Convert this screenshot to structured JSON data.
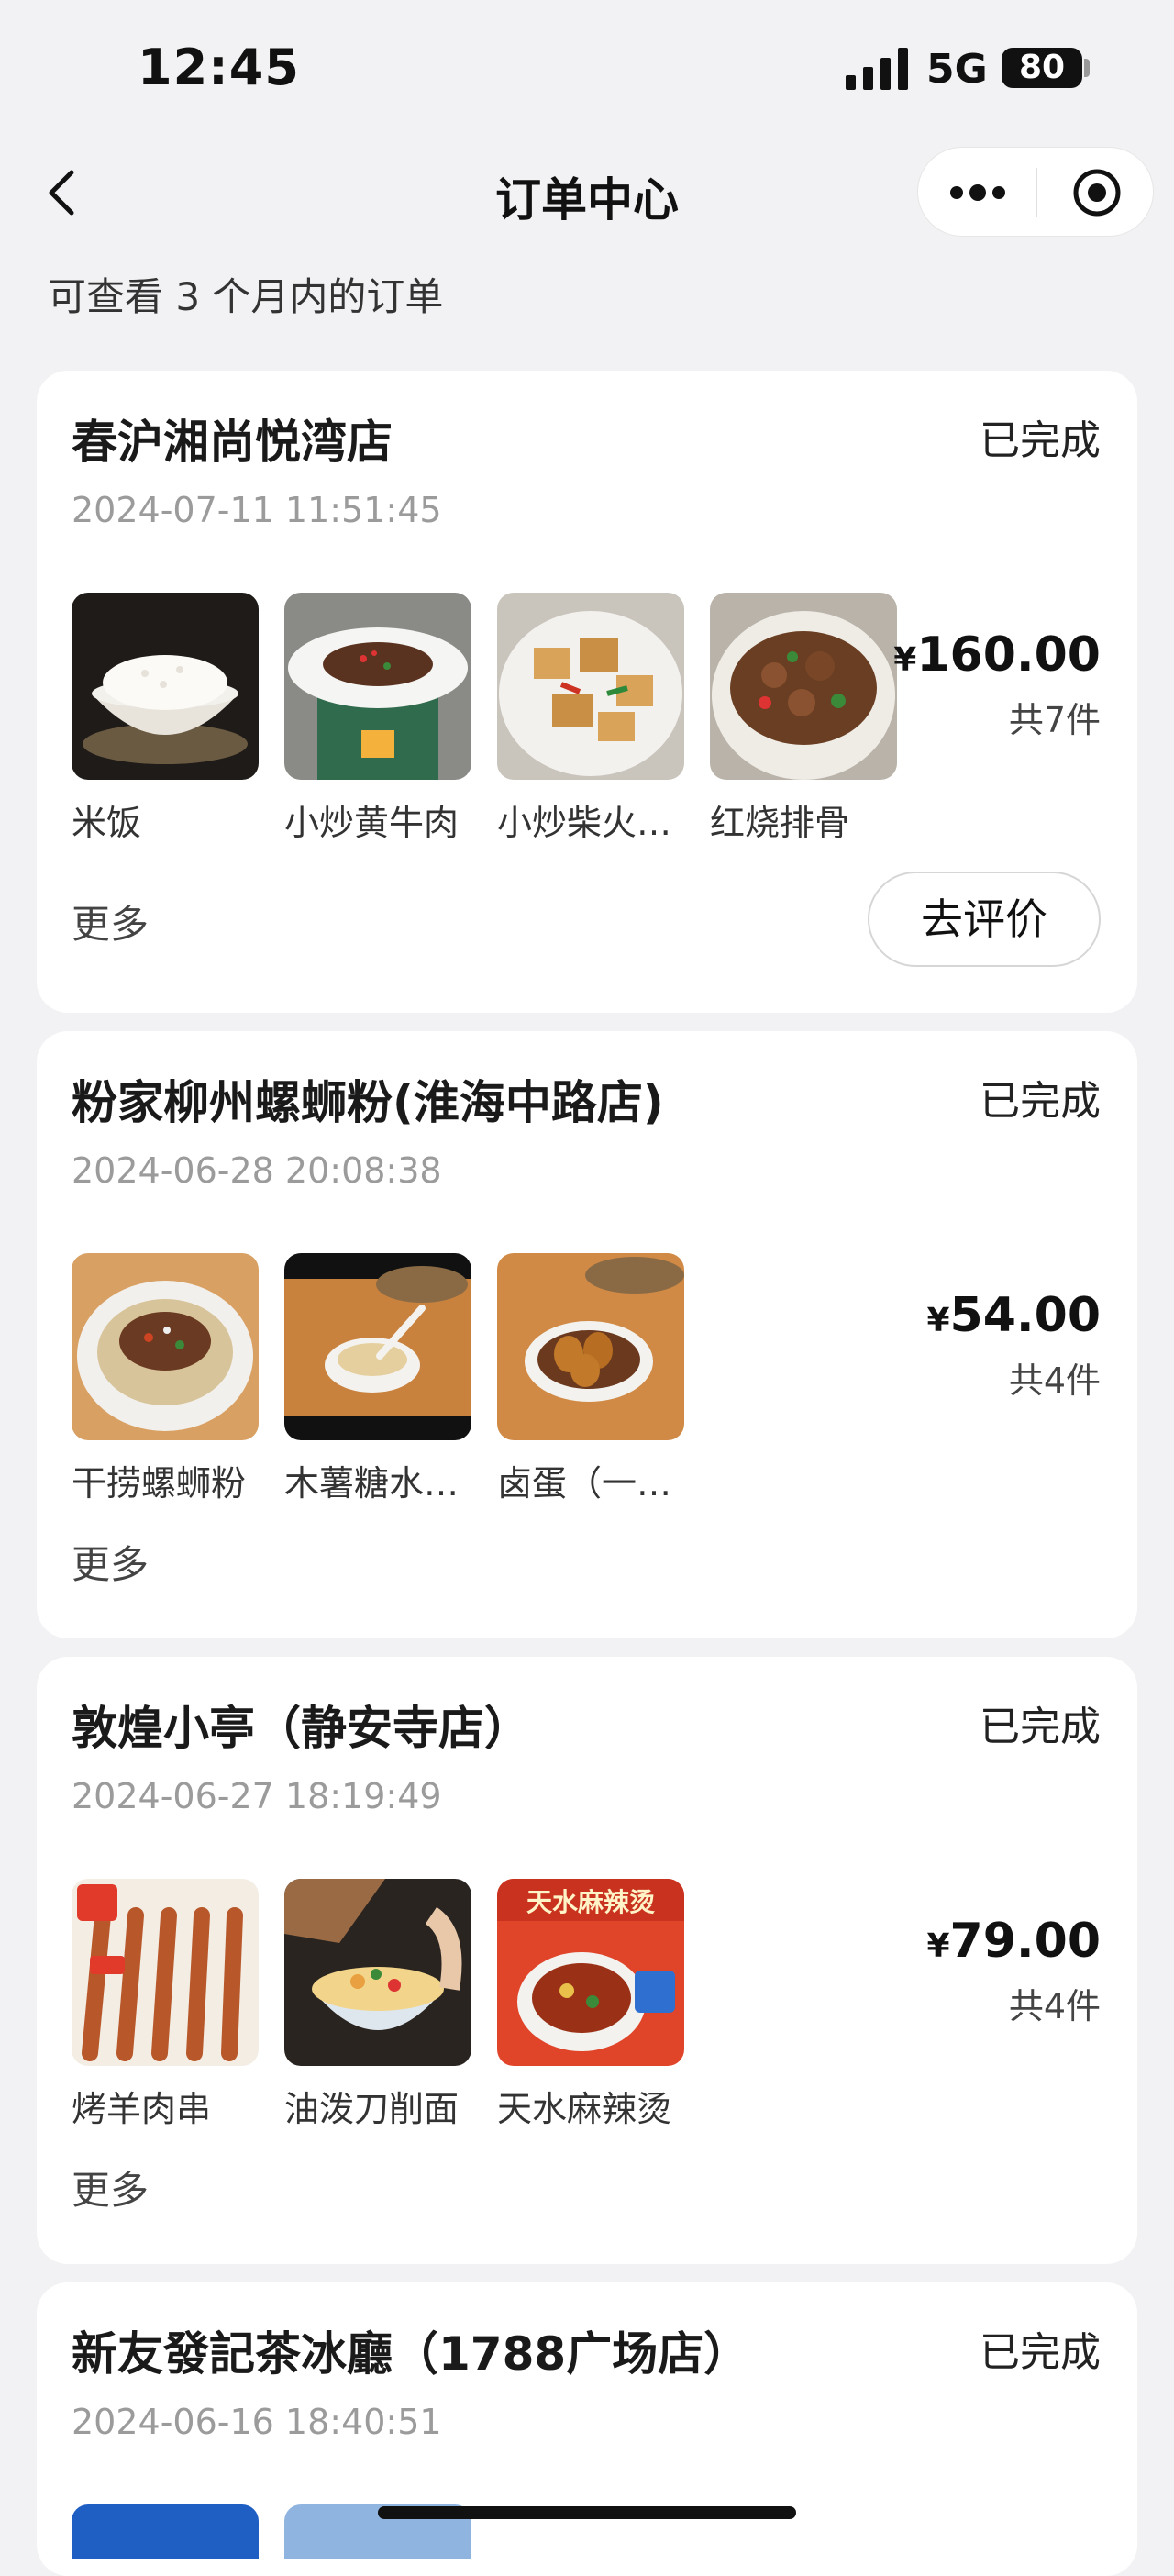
{
  "status_bar": {
    "time": "12:45",
    "network": "5G",
    "battery": "80"
  },
  "nav": {
    "title": "订单中心"
  },
  "subtitle": "可查看 3 个月内的订单",
  "orders": [
    {
      "store": "春沪湘尚悦湾店",
      "status": "已完成",
      "datetime": "2024-07-11 11:51:45",
      "items": [
        {
          "name": "米饭",
          "image": "rice-bowl"
        },
        {
          "name": "小炒黄牛肉",
          "image": "stir-fried-beef"
        },
        {
          "name": "小炒柴火…",
          "image": "stir-fried-tofu"
        },
        {
          "name": "红烧排骨",
          "image": "braised-ribs"
        }
      ],
      "currency": "¥",
      "price": "160.00",
      "count": "共7件",
      "more": "更多",
      "review": "去评价"
    },
    {
      "store": "粉家柳州螺蛳粉(淮海中路店)",
      "status": "已完成",
      "datetime": "2024-06-28 20:08:38",
      "items": [
        {
          "name": "干捞螺蛳粉",
          "image": "dry-snail-noodles"
        },
        {
          "name": "木薯糖水…",
          "image": "tapioca-sweet-soup"
        },
        {
          "name": "卤蛋（一…",
          "image": "braised-eggs"
        }
      ],
      "currency": "¥",
      "price": "54.00",
      "count": "共4件",
      "more": "更多"
    },
    {
      "store": "敦煌小亭（静安寺店）",
      "status": "已完成",
      "datetime": "2024-06-27 18:19:49",
      "items": [
        {
          "name": "烤羊肉串",
          "image": "lamb-skewers"
        },
        {
          "name": "油泼刀削面",
          "image": "knife-cut-noodles"
        },
        {
          "name": "天水麻辣烫",
          "image": "tianshui-malatang",
          "overlay": "天水麻辣烫"
        }
      ],
      "currency": "¥",
      "price": "79.00",
      "count": "共4件",
      "more": "更多"
    },
    {
      "store": "新友發記茶冰廳（1788广场店）",
      "status": "已完成",
      "datetime": "2024-06-16 18:40:51"
    }
  ],
  "colors": {
    "background": "#f2f2f4",
    "card": "#ffffff",
    "muted": "#9b9b9b"
  }
}
